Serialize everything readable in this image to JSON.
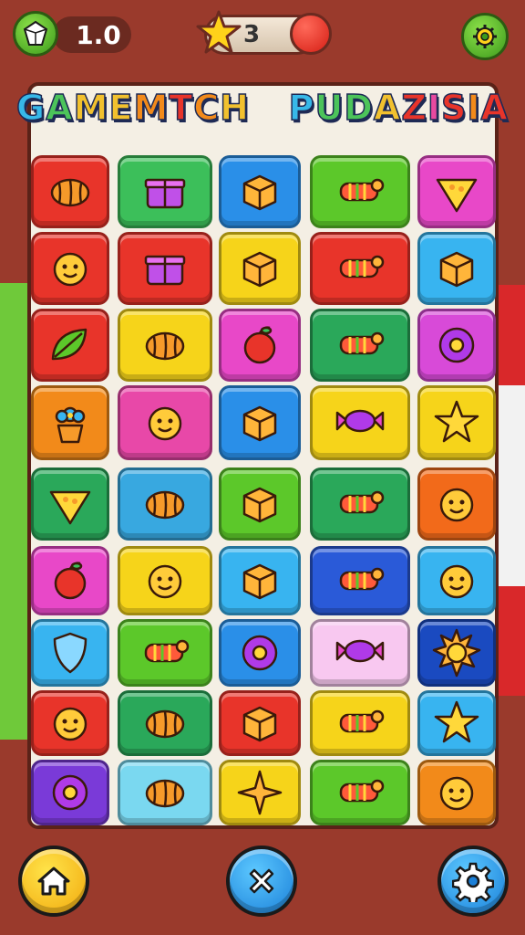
{
  "hud": {
    "level_value": "1.0",
    "stars_count": "3"
  },
  "title": {
    "word1": [
      {
        "ch": "G",
        "color": "#37b8e8"
      },
      {
        "ch": "A",
        "color": "#4cc45a"
      },
      {
        "ch": "M",
        "color": "#f2c12e"
      },
      {
        "ch": "E",
        "color": "#f2c12e"
      },
      {
        "ch": "M",
        "color": "#f28a1a"
      },
      {
        "ch": "T",
        "color": "#e8342a"
      },
      {
        "ch": "C",
        "color": "#f28a1a"
      },
      {
        "ch": "H",
        "color": "#f2c12e"
      }
    ],
    "word2": [
      {
        "ch": "P",
        "color": "#37b8e8"
      },
      {
        "ch": "U",
        "color": "#4cc45a"
      },
      {
        "ch": "D",
        "color": "#4cc45a"
      },
      {
        "ch": "A",
        "color": "#f2c12e"
      },
      {
        "ch": "Z",
        "color": "#e8342a"
      },
      {
        "ch": "I",
        "color": "#e84aa0"
      },
      {
        "ch": "S",
        "color": "#e8342a"
      },
      {
        "ch": "I",
        "color": "#f28a1a"
      },
      {
        "ch": "A",
        "color": "#e8342a"
      }
    ]
  },
  "board": {
    "rows": [
      [
        {
          "color": "#e8342a",
          "icon": "bread-icon"
        },
        {
          "color": "#3cbf5a",
          "icon": "gift-box-icon"
        },
        {
          "color": "#2a8fe8",
          "icon": "cube-icon"
        },
        {
          "color": "#5cc82a",
          "icon": "candy-roll-icon"
        },
        {
          "color": "#e848c8",
          "icon": "pizza-slice-icon"
        }
      ],
      [
        {
          "color": "#e8342a",
          "icon": "carrot-face-icon"
        },
        {
          "color": "#e8342a",
          "icon": "treasure-chest-icon"
        },
        {
          "color": "#f6d41a",
          "icon": "dice-icon"
        },
        {
          "color": "#e8342a",
          "icon": "candy-roll-icon"
        },
        {
          "color": "#38b4f0",
          "icon": "box-icon"
        }
      ],
      [
        {
          "color": "#e8342a",
          "icon": "leaf-icon"
        },
        {
          "color": "#f6d41a",
          "icon": "croissant-icon"
        },
        {
          "color": "#e848c8",
          "icon": "apple-icon"
        },
        {
          "color": "#2aa85a",
          "icon": "candy-roll-icon"
        },
        {
          "color": "#d84ad8",
          "icon": "donut-icon"
        }
      ],
      [
        {
          "color": "#f28a1a",
          "icon": "flower-pot-icon"
        },
        {
          "color": "#e848a8",
          "icon": "plant-face-icon"
        },
        {
          "color": "#2a8fe8",
          "icon": "apple-cube-icon"
        },
        {
          "color": "#f6d41a",
          "icon": "wrapped-candy-icon"
        },
        {
          "color": "#f6d41a",
          "icon": "star-icon"
        }
      ],
      [
        {
          "color": "#2aa85a",
          "icon": "cheese-icon"
        },
        {
          "color": "#38a8e0",
          "icon": "log-icon"
        },
        {
          "color": "#5cc82a",
          "icon": "cube-icon"
        },
        {
          "color": "#2aa85a",
          "icon": "candy-roll-icon"
        },
        {
          "color": "#f26a1a",
          "icon": "smiley-icon"
        }
      ],
      [
        {
          "color": "#e848c8",
          "icon": "plum-icon"
        },
        {
          "color": "#f6d41a",
          "icon": "smiley-icon"
        },
        {
          "color": "#38b4f0",
          "icon": "cube-icon"
        },
        {
          "color": "#2a5ad8",
          "icon": "candy-roll-icon"
        },
        {
          "color": "#38b4f0",
          "icon": "heart-face-icon"
        }
      ],
      [
        {
          "color": "#38b4f0",
          "icon": "shield-icon"
        },
        {
          "color": "#5cc82a",
          "icon": "roll-icon"
        },
        {
          "color": "#2a8fe8",
          "icon": "gear-fruit-icon"
        },
        {
          "color": "#f8c8f0",
          "icon": "wrapped-candy-icon"
        },
        {
          "color": "#1a4ac0",
          "icon": "sun-icon"
        }
      ],
      [
        {
          "color": "#e8342a",
          "icon": "carrot-face-icon"
        },
        {
          "color": "#2aa85a",
          "icon": "croissant-icon"
        },
        {
          "color": "#e8342a",
          "icon": "dice-icon"
        },
        {
          "color": "#f6d41a",
          "icon": "candy-roll-icon"
        },
        {
          "color": "#38b4f0",
          "icon": "star-icon"
        }
      ],
      [
        {
          "color": "#7a3ad8",
          "icon": "planet-icon"
        },
        {
          "color": "#7ad8f0",
          "icon": "pumpkin-icon"
        },
        {
          "color": "#f6d41a",
          "icon": "sparkle-icon"
        },
        {
          "color": "#5cc82a",
          "icon": "candy-roll-icon"
        },
        {
          "color": "#f28a1a",
          "icon": "smiley-icon"
        }
      ]
    ]
  },
  "buttons": {
    "home": "home-icon",
    "close": "close-icon",
    "settings": "gear-icon"
  }
}
